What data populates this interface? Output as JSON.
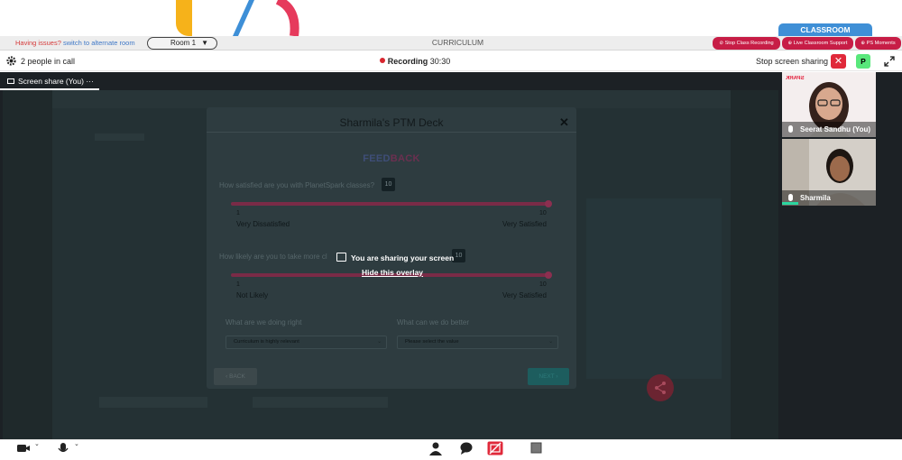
{
  "topbar": {
    "classroom_tab": "CLASSROOM",
    "issues_text": "Having issues?",
    "switch_link": "switch to alternate room",
    "room_selector": "Room 1",
    "center_tab": "CURRICULUM",
    "buttons": [
      "Stop Class Recording",
      "Live Classroom Support",
      "PS Moments"
    ]
  },
  "call": {
    "people_count": "2 people in call",
    "recording_label": "Recording",
    "recording_time": "30:30",
    "stop_sharing": "Stop screen sharing",
    "participant_badge": "P"
  },
  "stage": {
    "share_tab": "Screen share (You)",
    "share_tab_menu": "···"
  },
  "deck": {
    "title": "Sharmila's PTM Deck",
    "heading_part1": "FEED",
    "heading_part2": "BACK",
    "q1": {
      "text": "How satisfied are you with PlanetSpark classes?",
      "value": "10",
      "min": "1",
      "max": "10",
      "min_label": "Very Dissatisfied",
      "max_label": "Very Satisfied",
      "fraction": 1.0
    },
    "q2": {
      "text_visible": "How likely are you to take more cl",
      "value": "10",
      "min": "1",
      "max": "10",
      "min_label": "Not Likely",
      "max_label": "Very Satisfied",
      "fraction": 1.0
    },
    "right_label": "What are we doing right",
    "better_label": "What can we do better",
    "right_value": "Curriculum is highly relevant",
    "better_placeholder": "Please select the value",
    "back_button": "BACK",
    "next_button": "NEXT"
  },
  "overlay": {
    "sharing_text": "You are sharing your screen",
    "hide_link": "Hide this overlay"
  },
  "participants": [
    {
      "name": "Seerat Sandhu (You)"
    },
    {
      "name": "Sharmila"
    }
  ],
  "colors": {
    "accent_red": "#c71d46",
    "recording_dot": "#d8262f",
    "classroom_blue": "#3f8fd6",
    "badge_green": "#58e87b",
    "slider": "#7a2b47"
  }
}
